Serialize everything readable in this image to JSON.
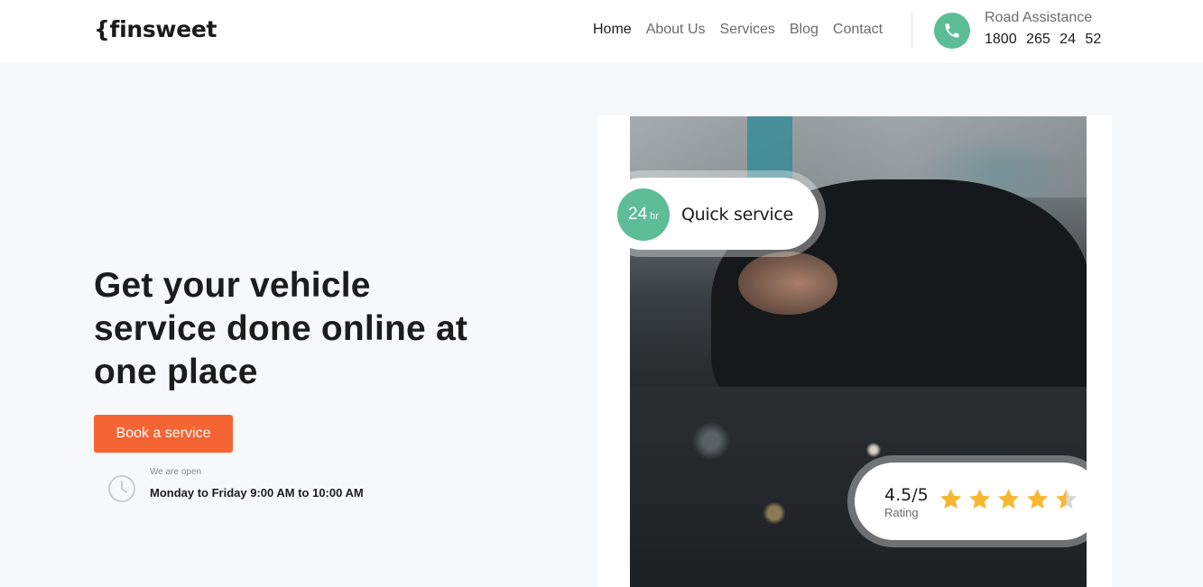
{
  "header": {
    "logo": "{finsweet",
    "nav": [
      "Home",
      "About Us",
      "Services",
      "Blog",
      "Contact"
    ],
    "active_nav": "Home",
    "road_assistance_label": "Road Assistance",
    "road_assistance_number": "1800 265 24 52"
  },
  "hero": {
    "headline": "Get your vehicle service done online at one place",
    "book_button": "Book a service",
    "open_label": "We are open",
    "hours": "Monday to Friday 9:00 AM to 10:00 AM"
  },
  "quick_service": {
    "badge_number": "24",
    "badge_unit": "hr",
    "label": "Quick service"
  },
  "rating": {
    "score": "4.5/5",
    "label": "Rating",
    "stars_value": 4.5,
    "stars_max": 5
  },
  "colors": {
    "accent_orange": "#f56533",
    "accent_green": "#5cbd97",
    "star_yellow": "#f7b731",
    "background": "#f7f8fa"
  },
  "icons": {
    "phone": "phone-icon",
    "clock": "clock-icon",
    "star": "star-icon"
  }
}
